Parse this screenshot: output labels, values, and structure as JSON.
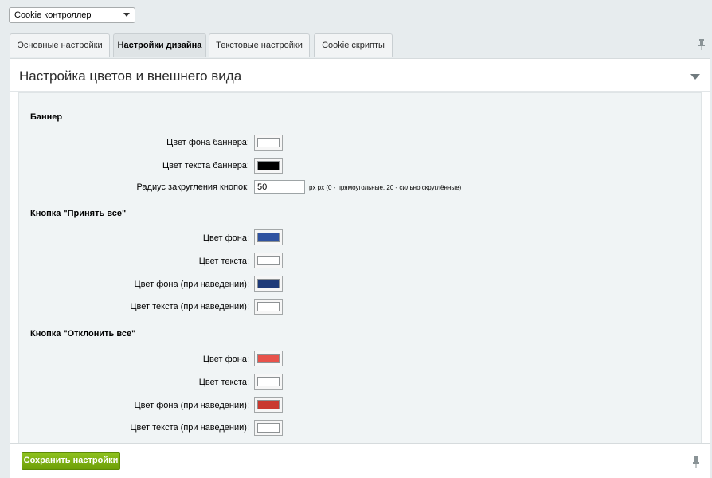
{
  "module_select": {
    "value": "Cookie контроллер"
  },
  "tabs": [
    {
      "label": "Основные настройки",
      "active": false
    },
    {
      "label": "Настройки дизайна",
      "active": true
    },
    {
      "label": "Текстовые настройки",
      "active": false
    },
    {
      "label": "Cookie скрипты",
      "active": false
    }
  ],
  "panel": {
    "title": "Настройка цветов и внешнего вида"
  },
  "banner": {
    "title": "Баннер",
    "bg_label": "Цвет фона баннера:",
    "bg_color": "#ffffff",
    "text_label": "Цвет текста баннера:",
    "text_color": "#000000",
    "radius_label": "Радиус закругления кнопок:",
    "radius_value": "50",
    "radius_hint": "px px (0 - прямоугольные, 20 - сильно скруглённые)"
  },
  "accept": {
    "title": "Кнопка \"Принять все\"",
    "bg_label": "Цвет фона:",
    "bg_color": "#2f52a0",
    "text_label": "Цвет текста:",
    "text_color": "#ffffff",
    "hover_bg_label": "Цвет фона (при наведении):",
    "hover_bg_color": "#1e3a78",
    "hover_text_label": "Цвет текста (при наведении):",
    "hover_text_color": "#ffffff"
  },
  "reject": {
    "title": "Кнопка \"Отклонить все\"",
    "bg_label": "Цвет фона:",
    "bg_color": "#e8524a",
    "text_label": "Цвет текста:",
    "text_color": "#ffffff",
    "hover_bg_label": "Цвет фона (при наведении):",
    "hover_bg_color": "#c9392f",
    "hover_text_label": "Цвет текста (при наведении):",
    "hover_text_color": "#ffffff"
  },
  "footer": {
    "save_label": "Сохранить настройки"
  },
  "icons": {
    "pin": "pin-icon",
    "collapse": "chevron-down-icon",
    "select_arrow": "chevron-down-icon"
  }
}
